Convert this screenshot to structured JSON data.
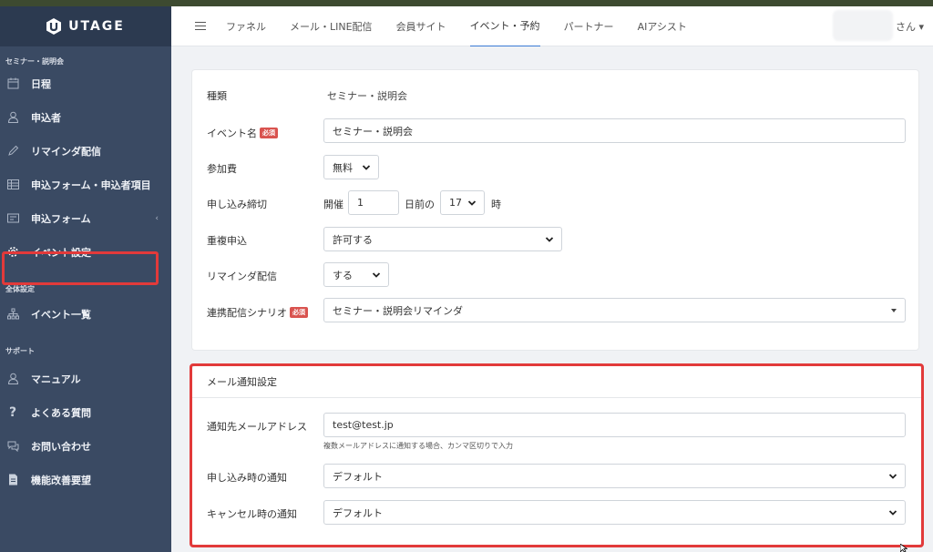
{
  "brand": {
    "name": "UTAGE"
  },
  "nav": {
    "tabs": [
      "ファネル",
      "メール・LINE配信",
      "会員サイト",
      "イベント・予約",
      "パートナー",
      "AIアシスト"
    ],
    "active_index": 3,
    "user_suffix": "さん ▾"
  },
  "sidebar": {
    "section1": "セミナー・説明会",
    "items1": [
      {
        "label": "日程",
        "icon": "calendar-icon"
      },
      {
        "label": "申込者",
        "icon": "person-icon"
      },
      {
        "label": "リマインダ配信",
        "icon": "pencil-icon"
      },
      {
        "label": "申込フォーム・申込者項目",
        "icon": "table-icon"
      },
      {
        "label": "申込フォーム",
        "icon": "form-icon"
      },
      {
        "label": "イベント設定",
        "icon": "gear-icon"
      }
    ],
    "section2": "全体設定",
    "items2": [
      {
        "label": "イベント一覧",
        "icon": "sitemap-icon"
      }
    ],
    "section3": "サポート",
    "items3": [
      {
        "label": "マニュアル",
        "icon": "person-icon"
      },
      {
        "label": "よくある質問",
        "icon": "question-icon"
      },
      {
        "label": "お問い合わせ",
        "icon": "chat-icon"
      },
      {
        "label": "機能改善要望",
        "icon": "document-icon"
      }
    ],
    "active_label": "イベント設定"
  },
  "form": {
    "type_label": "種類",
    "type_value": "セミナー・説明会",
    "event_name_label": "イベント名",
    "required_badge": "必須",
    "event_name_value": "セミナー・説明会",
    "fee_label": "参加費",
    "fee_value": "無料",
    "deadline_label": "申し込み締切",
    "deadline_prefix": "開催",
    "deadline_days": "1",
    "deadline_days_unit": "日前の",
    "deadline_hour": "17",
    "deadline_hour_unit": "時",
    "duplicate_label": "重複申込",
    "duplicate_value": "許可する",
    "reminder_label": "リマインダ配信",
    "reminder_value": "する",
    "scenario_label": "連携配信シナリオ",
    "scenario_value": "セミナー・説明会リマインダ"
  },
  "mail": {
    "header": "メール通知設定",
    "address_label": "通知先メールアドレス",
    "address_value": "test@test.jp",
    "address_help": "複数メールアドレスに通知する場合、カンマ区切りで入力",
    "apply_label": "申し込み時の通知",
    "apply_value": "デフォルト",
    "cancel_label": "キャンセル時の通知",
    "cancel_value": "デフォルト"
  }
}
